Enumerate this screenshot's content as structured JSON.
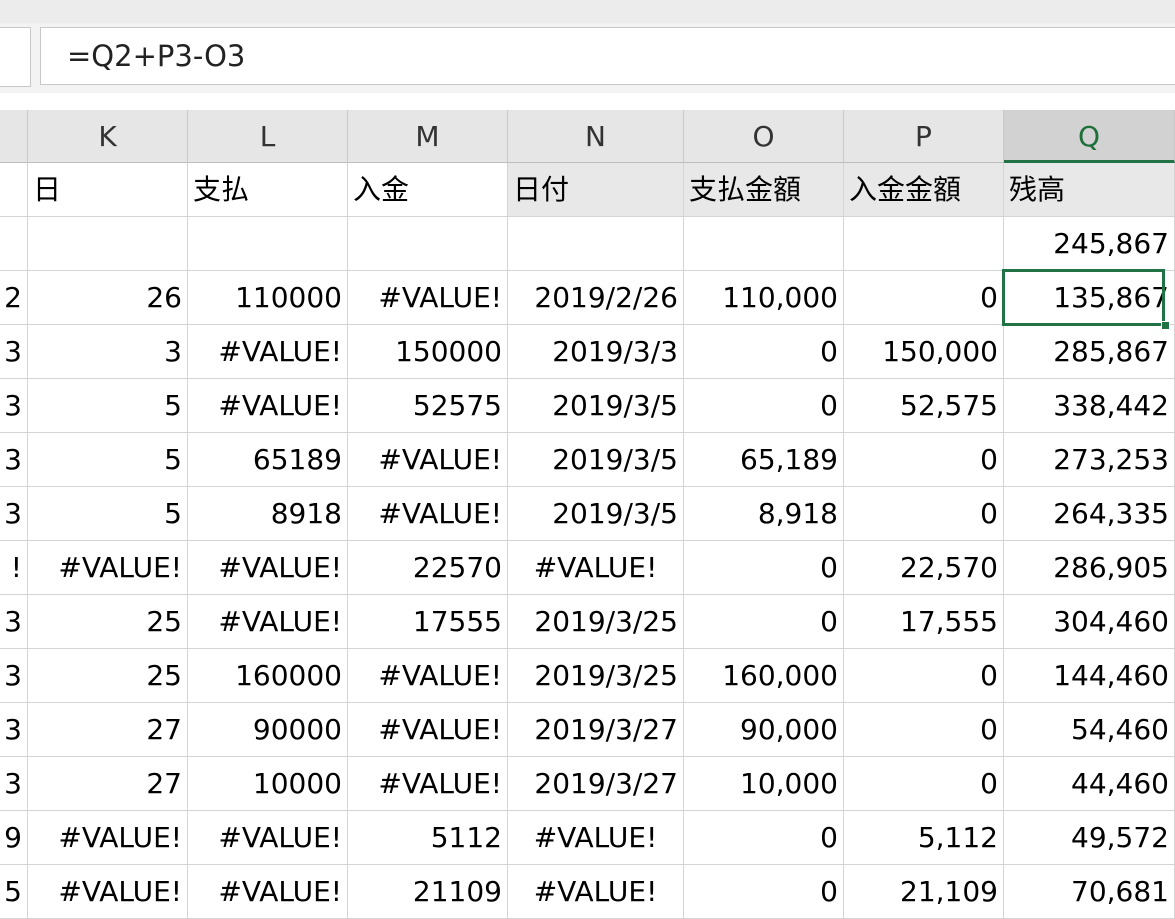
{
  "formula_bar": {
    "name_box_text": "",
    "formula": "=Q2+P3-O3"
  },
  "columns": [
    {
      "id": "J",
      "label": ""
    },
    {
      "id": "K",
      "label": "K"
    },
    {
      "id": "L",
      "label": "L"
    },
    {
      "id": "M",
      "label": "M"
    },
    {
      "id": "N",
      "label": "N"
    },
    {
      "id": "O",
      "label": "O"
    },
    {
      "id": "P",
      "label": "P"
    },
    {
      "id": "Q",
      "label": "Q"
    }
  ],
  "selected_column": "Q",
  "selected_cell": "Q3",
  "rows": [
    [
      "",
      "日",
      "支払",
      "入金",
      "日付",
      "支払金額",
      "入金金額",
      "残高"
    ],
    [
      "",
      "",
      "",
      "",
      "",
      "",
      "",
      "245,867"
    ],
    [
      "2",
      "26",
      "110000",
      "#VALUE!",
      "2019/2/26",
      "110,000",
      "0",
      "135,867"
    ],
    [
      "3",
      "3",
      "#VALUE!",
      "150000",
      "2019/3/3",
      "0",
      "150,000",
      "285,867"
    ],
    [
      "3",
      "5",
      "#VALUE!",
      "52575",
      "2019/3/5",
      "0",
      "52,575",
      "338,442"
    ],
    [
      "3",
      "5",
      "65189",
      "#VALUE!",
      "2019/3/5",
      "65,189",
      "0",
      "273,253"
    ],
    [
      "3",
      "5",
      "8918",
      "#VALUE!",
      "2019/3/5",
      "8,918",
      "0",
      "264,335"
    ],
    [
      "!",
      "#VALUE!",
      "#VALUE!",
      "22570",
      "#VALUE!",
      "0",
      "22,570",
      "286,905"
    ],
    [
      "3",
      "25",
      "#VALUE!",
      "17555",
      "2019/3/25",
      "0",
      "17,555",
      "304,460"
    ],
    [
      "3",
      "25",
      "160000",
      "#VALUE!",
      "2019/3/25",
      "160,000",
      "0",
      "144,460"
    ],
    [
      "3",
      "27",
      "90000",
      "#VALUE!",
      "2019/3/27",
      "90,000",
      "0",
      "54,460"
    ],
    [
      "3",
      "27",
      "10000",
      "#VALUE!",
      "2019/3/27",
      "10,000",
      "0",
      "44,460"
    ],
    [
      "9",
      "#VALUE!",
      "#VALUE!",
      "5112",
      "#VALUE!",
      "0",
      "5,112",
      "49,572"
    ],
    [
      "5",
      "#VALUE!",
      "#VALUE!",
      "21109",
      "#VALUE!",
      "0",
      "21,109",
      "70,681"
    ]
  ],
  "colors": {
    "accent": "#217346",
    "header_bg": "#e6e6e6",
    "gridline": "#d4d4d4"
  }
}
